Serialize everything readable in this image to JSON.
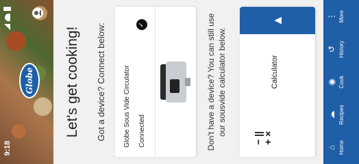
{
  "status_bar": {
    "time": "9:18"
  },
  "brand": {
    "logo_text": "Globe"
  },
  "main": {
    "title": "Let's get cooking!",
    "subtitle": "Got a device? Connect below:",
    "device": {
      "name": "Globe Sous Vide Circulator",
      "status": "Connected"
    },
    "no_device_text": "Don't have a device? You can still use our sousvide calculator below.",
    "calculator": {
      "label": "Calculator",
      "symbols": "− ||\n+ ×"
    }
  },
  "nav": [
    {
      "label": "Home",
      "icon": "home-icon"
    },
    {
      "label": "Recipes",
      "icon": "recipes-icon"
    },
    {
      "label": "Cook",
      "icon": "cook-icon"
    },
    {
      "label": "History",
      "icon": "history-icon"
    },
    {
      "label": "More",
      "icon": "more-icon"
    }
  ],
  "colors": {
    "brand_blue": "#1f5fa8",
    "background": "#f1f1f1"
  }
}
